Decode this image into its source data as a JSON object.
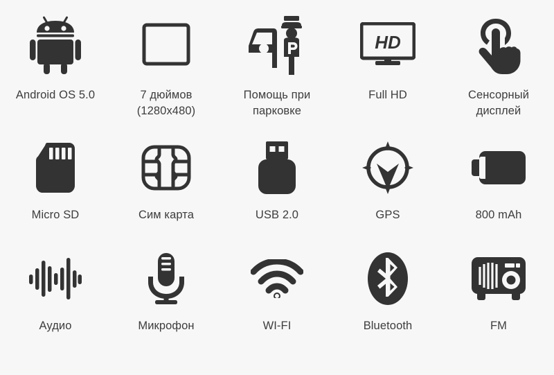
{
  "page": {
    "background_color": "#f7f7f7",
    "icon_color": "#333333",
    "text_color": "#3d3d3d",
    "columns": 5,
    "rows": 3
  },
  "features": [
    {
      "icon": "android-robot-icon",
      "label": "Android OS 5.0"
    },
    {
      "icon": "tablet-screen-icon",
      "label": "7 дюймов\n(1280x480)"
    },
    {
      "icon": "parking-assist-icon",
      "label": "Помощь при\nпарковке"
    },
    {
      "icon": "hd-monitor-icon",
      "label": "Full HD"
    },
    {
      "icon": "touch-hand-icon",
      "label": "Сенсорный\nдисплей"
    },
    {
      "icon": "micro-sd-card-icon",
      "label": "Micro SD"
    },
    {
      "icon": "sim-card-icon",
      "label": "Сим карта"
    },
    {
      "icon": "usb-flash-drive-icon",
      "label": "USB 2.0"
    },
    {
      "icon": "gps-target-icon",
      "label": "GPS"
    },
    {
      "icon": "battery-icon",
      "label": "800 mAh"
    },
    {
      "icon": "audio-waveform-icon",
      "label": "Аудио"
    },
    {
      "icon": "microphone-icon",
      "label": "Микрофон"
    },
    {
      "icon": "wifi-icon",
      "label": "WI-FI"
    },
    {
      "icon": "bluetooth-icon",
      "label": "Bluetooth"
    },
    {
      "icon": "fm-radio-icon",
      "label": "FM"
    }
  ]
}
